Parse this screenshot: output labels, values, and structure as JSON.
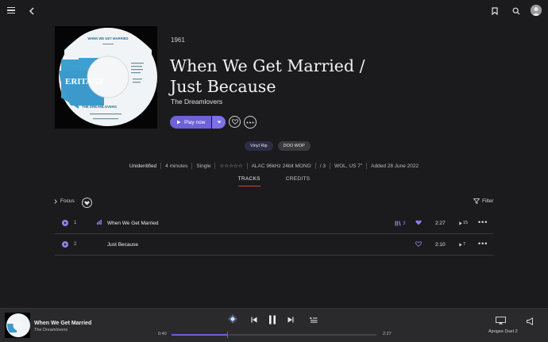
{
  "header": {
    "menu_icon": "menu-icon",
    "back_icon": "chevron-left-icon",
    "bookmark_icon": "bookmark-icon",
    "search_icon": "search-icon",
    "avatar_icon": "avatar"
  },
  "album": {
    "year": "1961",
    "title_line1": "When We Get Married /",
    "title_line2": "Just Because",
    "artist": "The Dreamlovers",
    "label_text": "ERITAGE",
    "label_song": "WHEN WE GET MARRIED",
    "label_artist": "THE DREAMLOVERS",
    "play_label": "Play now"
  },
  "tags": [
    "Vinyl Rip",
    "DOO WOP"
  ],
  "meta": [
    "Unidentified",
    "4 minutes",
    "Single",
    "☆☆☆☆☆",
    "ALAC 96kHz 24bit MONO",
    "/ 3",
    "WOL, US 7\"",
    "Added 28 June 2022"
  ],
  "tabs": [
    {
      "label": "TRACKS",
      "active": true
    },
    {
      "label": "CREDITS",
      "active": false
    }
  ],
  "focus_label": "Focus",
  "filter_label": "Filter",
  "tracks": [
    {
      "num": "1",
      "title": "When We Get Married",
      "versions": "3",
      "favorite": true,
      "duration": "2:27",
      "plays": "15"
    },
    {
      "num": "2",
      "title": "Just Because",
      "versions": "",
      "favorite": false,
      "duration": "2:10",
      "plays": "7"
    }
  ],
  "player": {
    "title": "When We Get Married",
    "artist": "The Dreamlovers",
    "time_current": "0:40",
    "time_total": "2:27",
    "progress": 0.27,
    "device": "Apogee Duet 2"
  },
  "colors": {
    "accent": "#6d63d6",
    "accent_light": "#8b82ea",
    "background": "#1b1b1d",
    "playbar": "#2a2a2c",
    "tab_underline": "#c8463c"
  }
}
